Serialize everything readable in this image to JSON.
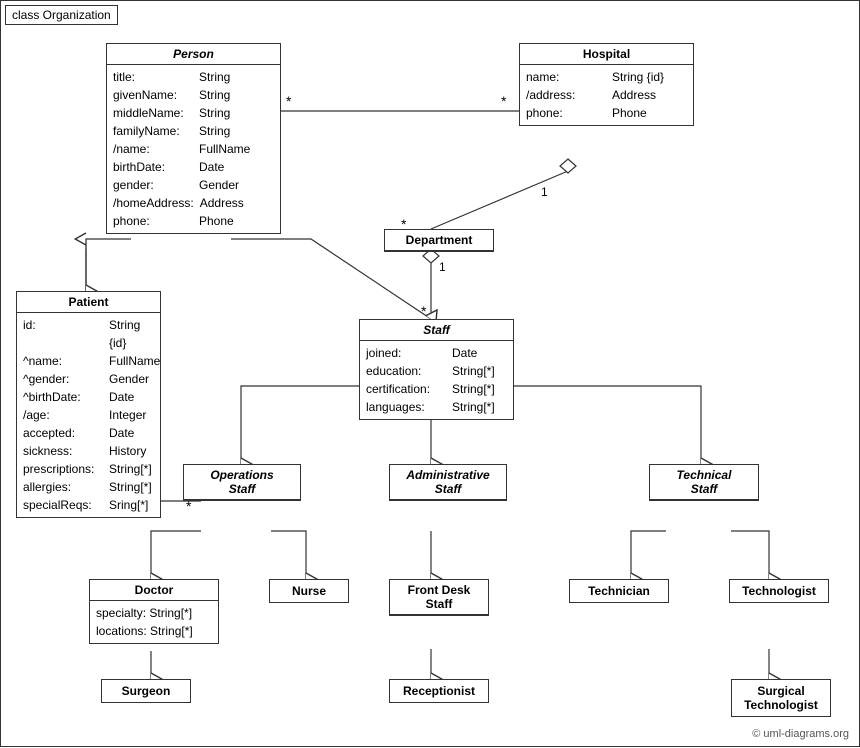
{
  "title": "class Organization",
  "copyright": "© uml-diagrams.org",
  "classes": {
    "person": {
      "name": "Person",
      "italic": true,
      "attrs": [
        {
          "name": "title:",
          "type": "String"
        },
        {
          "name": "givenName:",
          "type": "String"
        },
        {
          "name": "middleName:",
          "type": "String"
        },
        {
          "name": "familyName:",
          "type": "String"
        },
        {
          "name": "/name:",
          "type": "FullName"
        },
        {
          "name": "birthDate:",
          "type": "Date"
        },
        {
          "name": "gender:",
          "type": "Gender"
        },
        {
          "name": "/homeAddress:",
          "type": "Address"
        },
        {
          "name": "phone:",
          "type": "Phone"
        }
      ]
    },
    "hospital": {
      "name": "Hospital",
      "italic": false,
      "attrs": [
        {
          "name": "name:",
          "type": "String {id}"
        },
        {
          "name": "/address:",
          "type": "Address"
        },
        {
          "name": "phone:",
          "type": "Phone"
        }
      ]
    },
    "department": {
      "name": "Department",
      "italic": false,
      "attrs": []
    },
    "staff": {
      "name": "Staff",
      "italic": true,
      "attrs": [
        {
          "name": "joined:",
          "type": "Date"
        },
        {
          "name": "education:",
          "type": "String[*]"
        },
        {
          "name": "certification:",
          "type": "String[*]"
        },
        {
          "name": "languages:",
          "type": "String[*]"
        }
      ]
    },
    "patient": {
      "name": "Patient",
      "italic": false,
      "attrs": [
        {
          "name": "id:",
          "type": "String {id}"
        },
        {
          "name": "^name:",
          "type": "FullName"
        },
        {
          "name": "^gender:",
          "type": "Gender"
        },
        {
          "name": "^birthDate:",
          "type": "Date"
        },
        {
          "name": "/age:",
          "type": "Integer"
        },
        {
          "name": "accepted:",
          "type": "Date"
        },
        {
          "name": "sickness:",
          "type": "History"
        },
        {
          "name": "prescriptions:",
          "type": "String[*]"
        },
        {
          "name": "allergies:",
          "type": "String[*]"
        },
        {
          "name": "specialReqs:",
          "type": "Sring[*]"
        }
      ]
    },
    "operations_staff": {
      "name": "Operations Staff",
      "italic": true
    },
    "administrative_staff": {
      "name": "Administrative Staff",
      "italic": true
    },
    "technical_staff": {
      "name": "Technical Staff",
      "italic": true
    },
    "doctor": {
      "name": "Doctor",
      "attrs": [
        {
          "name": "specialty:",
          "type": "String[*]"
        },
        {
          "name": "locations:",
          "type": "String[*]"
        }
      ]
    },
    "nurse": {
      "name": "Nurse"
    },
    "front_desk_staff": {
      "name": "Front Desk Staff"
    },
    "technician": {
      "name": "Technician"
    },
    "technologist": {
      "name": "Technologist"
    },
    "surgeon": {
      "name": "Surgeon"
    },
    "receptionist": {
      "name": "Receptionist"
    },
    "surgical_technologist": {
      "name": "Surgical Technologist"
    }
  }
}
